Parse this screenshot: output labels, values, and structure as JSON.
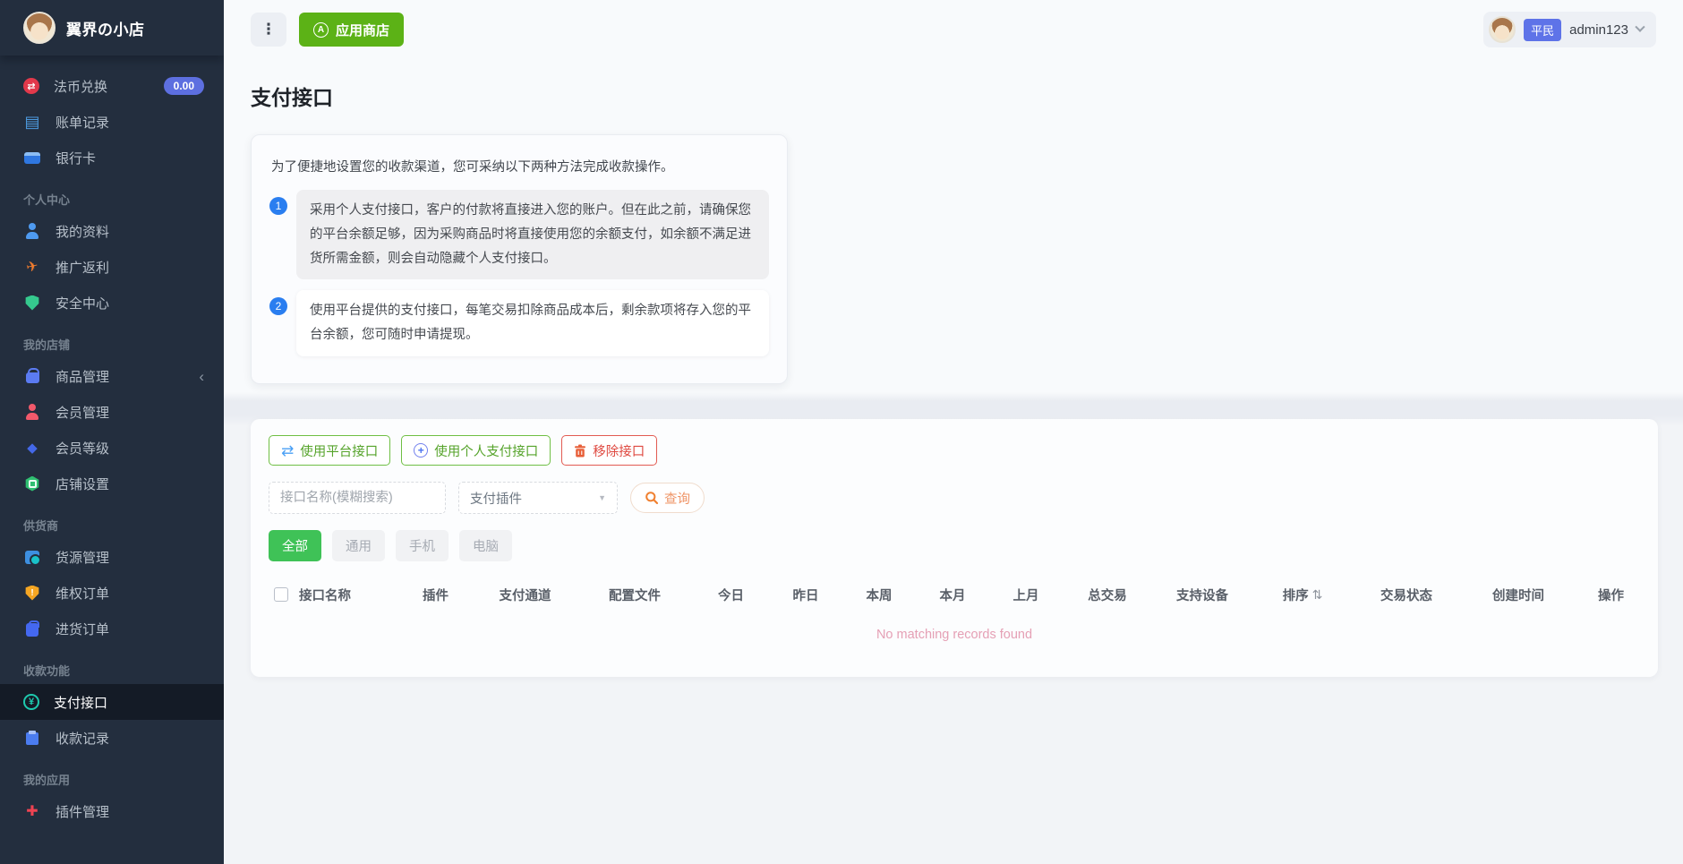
{
  "brand": "翼界の小店",
  "topbar": {
    "app_store_label": "应用商店",
    "user": {
      "role_badge": "平民",
      "username": "admin123"
    }
  },
  "sidebar": {
    "sections": [
      {
        "header": "",
        "items": [
          {
            "label": "法币兑换",
            "icon": "currency-exchange-icon",
            "badge": "0.00"
          },
          {
            "label": "账单记录",
            "icon": "bill-records-icon"
          },
          {
            "label": "银行卡",
            "icon": "bank-card-icon"
          }
        ]
      },
      {
        "header": "个人中心",
        "items": [
          {
            "label": "我的资料",
            "icon": "profile-icon"
          },
          {
            "label": "推广返利",
            "icon": "promotion-rebate-icon"
          },
          {
            "label": "安全中心",
            "icon": "security-shield-icon"
          }
        ]
      },
      {
        "header": "我的店铺",
        "items": [
          {
            "label": "商品管理",
            "icon": "product-bag-icon",
            "collapsible": true
          },
          {
            "label": "会员管理",
            "icon": "member-icon"
          },
          {
            "label": "会员等级",
            "icon": "member-level-icon"
          },
          {
            "label": "店铺设置",
            "icon": "shop-settings-icon"
          }
        ]
      },
      {
        "header": "供货商",
        "items": [
          {
            "label": "货源管理",
            "icon": "supply-source-icon"
          },
          {
            "label": "维权订单",
            "icon": "dispute-order-icon"
          },
          {
            "label": "进货订单",
            "icon": "purchase-order-icon"
          }
        ]
      },
      {
        "header": "收款功能",
        "items": [
          {
            "label": "支付接口",
            "icon": "payment-interface-icon",
            "active": true
          },
          {
            "label": "收款记录",
            "icon": "payment-records-icon"
          }
        ]
      },
      {
        "header": "我的应用",
        "items": [
          {
            "label": "插件管理",
            "icon": "plugin-icon"
          }
        ]
      }
    ]
  },
  "page": {
    "title": "支付接口",
    "notice": {
      "intro": "为了便捷地设置您的收款渠道，您可采纳以下两种方法完成收款操作。",
      "items": [
        {
          "num": "1",
          "text": "采用个人支付接口，客户的付款将直接进入您的账户。但在此之前，请确保您的平台余额足够，因为采购商品时将直接使用您的余额支付，如余额不满足进货所需金额，则会自动隐藏个人支付接口。"
        },
        {
          "num": "2",
          "text": "使用平台提供的支付接口，每笔交易扣除商品成本后，剩余款项将存入您的平台余额，您可随时申请提现。"
        }
      ]
    },
    "actions": [
      {
        "label": "使用平台接口",
        "icon": "exchange-arrows-icon",
        "style": "green"
      },
      {
        "label": "使用个人支付接口",
        "icon": "plus-circle-icon",
        "style": "green"
      },
      {
        "label": "移除接口",
        "icon": "trash-icon",
        "style": "red"
      }
    ],
    "filters": {
      "search_placeholder": "接口名称(模糊搜索)",
      "plugin_select_value": "支付插件",
      "query_label": "查询"
    },
    "device_tabs": [
      {
        "label": "全部",
        "active": true
      },
      {
        "label": "通用"
      },
      {
        "label": "手机"
      },
      {
        "label": "电脑"
      }
    ],
    "table": {
      "columns": [
        "接口名称",
        "插件",
        "支付通道",
        "配置文件",
        "今日",
        "昨日",
        "本周",
        "本月",
        "上月",
        "总交易",
        "支持设备",
        "排序",
        "交易状态",
        "创建时间",
        "操作"
      ],
      "sortable_column": "排序",
      "empty_text": "No matching records found"
    }
  },
  "colors": {
    "sidebar_bg": "#232e3e",
    "appstore_green": "#5cb216",
    "tab_active_green": "#3fc257",
    "query_orange": "#f08030",
    "badge_indigo": "#5d6fe0",
    "role_badge_blue": "#5e73e8",
    "notice_number_blue": "#2a7ef0",
    "empty_text_pink": "#e5a0b5",
    "danger_red": "#e25b52",
    "outline_green": "#6fbf44"
  }
}
